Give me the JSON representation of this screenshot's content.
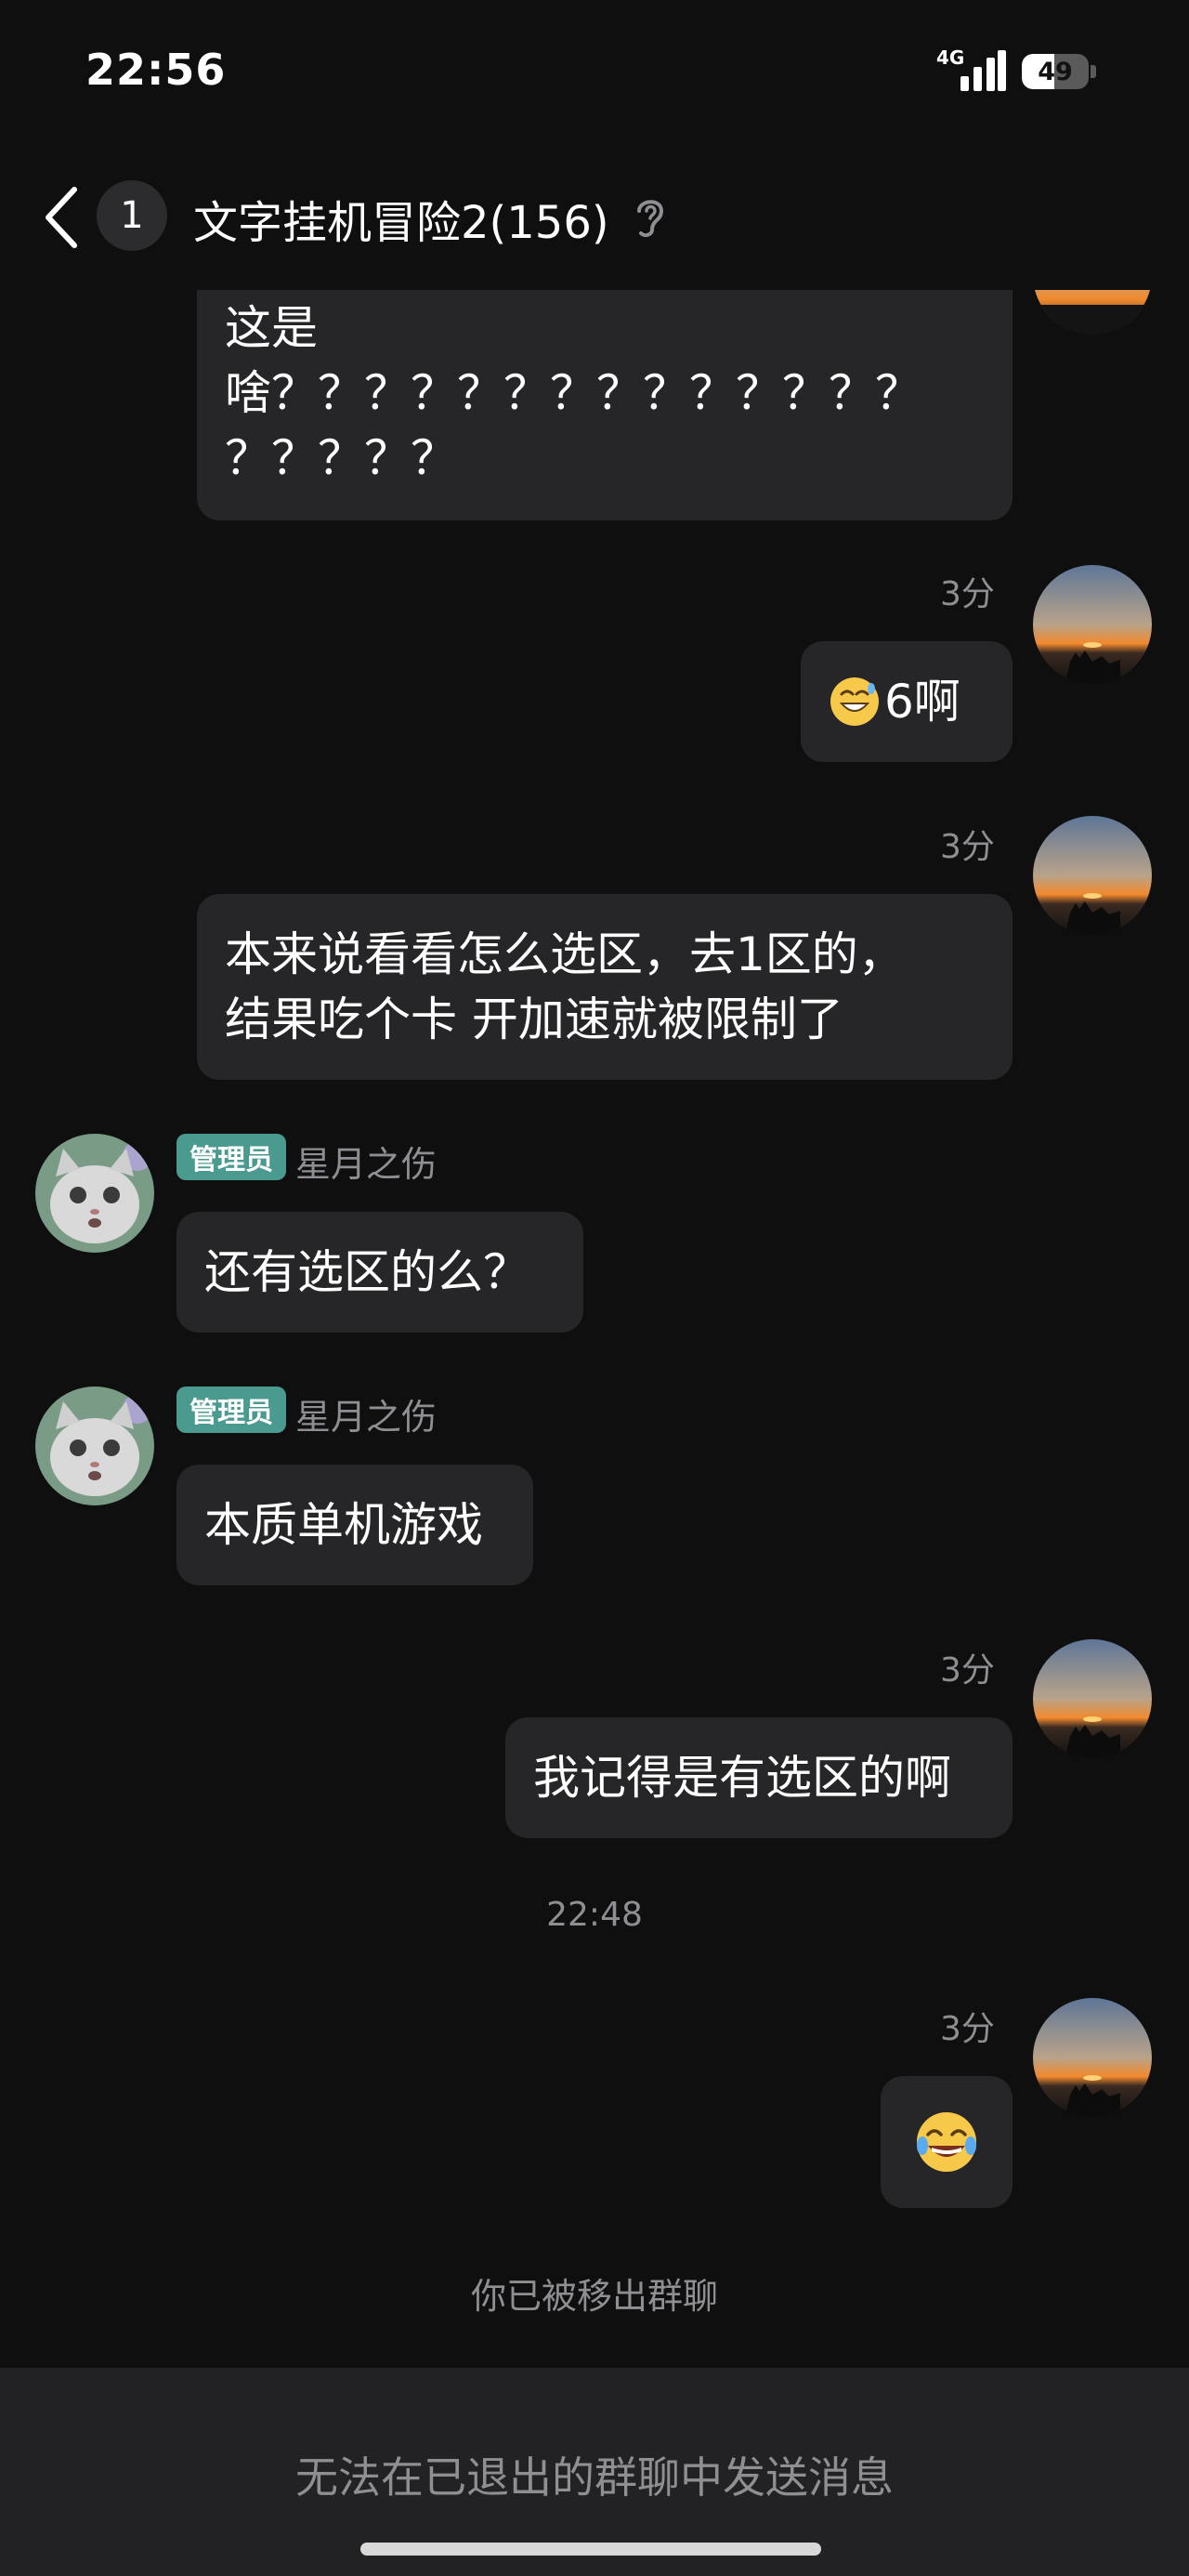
{
  "status_bar": {
    "time": "22:56",
    "network": "4G",
    "battery": "49",
    "battery_level_pct": 49
  },
  "header": {
    "unread_count": "1",
    "title": "文字挂机冒险2(156)"
  },
  "messages": {
    "m1": {
      "text": "这是\n啥？？？？？？？？？？？？？？\n？？？？？"
    },
    "m2": {
      "time": "3分",
      "text": "6啊",
      "emoji": "grinning-face-with-sweat-emoji"
    },
    "m3": {
      "time": "3分",
      "text": "本来说看看怎么选区，去1区的，\n结果吃个卡 开加速就被限制了"
    },
    "m4": {
      "badge": "管理员",
      "sender": "星月之伤",
      "text": "还有选区的么？"
    },
    "m5": {
      "badge": "管理员",
      "sender": "星月之伤",
      "text": "本质单机游戏"
    },
    "m6": {
      "time": "3分",
      "text": "我记得是有选区的啊"
    },
    "divider_time": "22:48",
    "m7": {
      "time": "3分",
      "emoji": "face-with-tears-of-joy-emoji"
    },
    "system": "你已被移出群聊"
  },
  "bottom": {
    "notice": "无法在已退出的群聊中发送消息"
  },
  "colors": {
    "background": "#0f0f10",
    "bubble": "#262628",
    "admin_badge": "#4a9a8f",
    "muted_text": "#8e8e93",
    "bottom_bar": "#222224"
  }
}
